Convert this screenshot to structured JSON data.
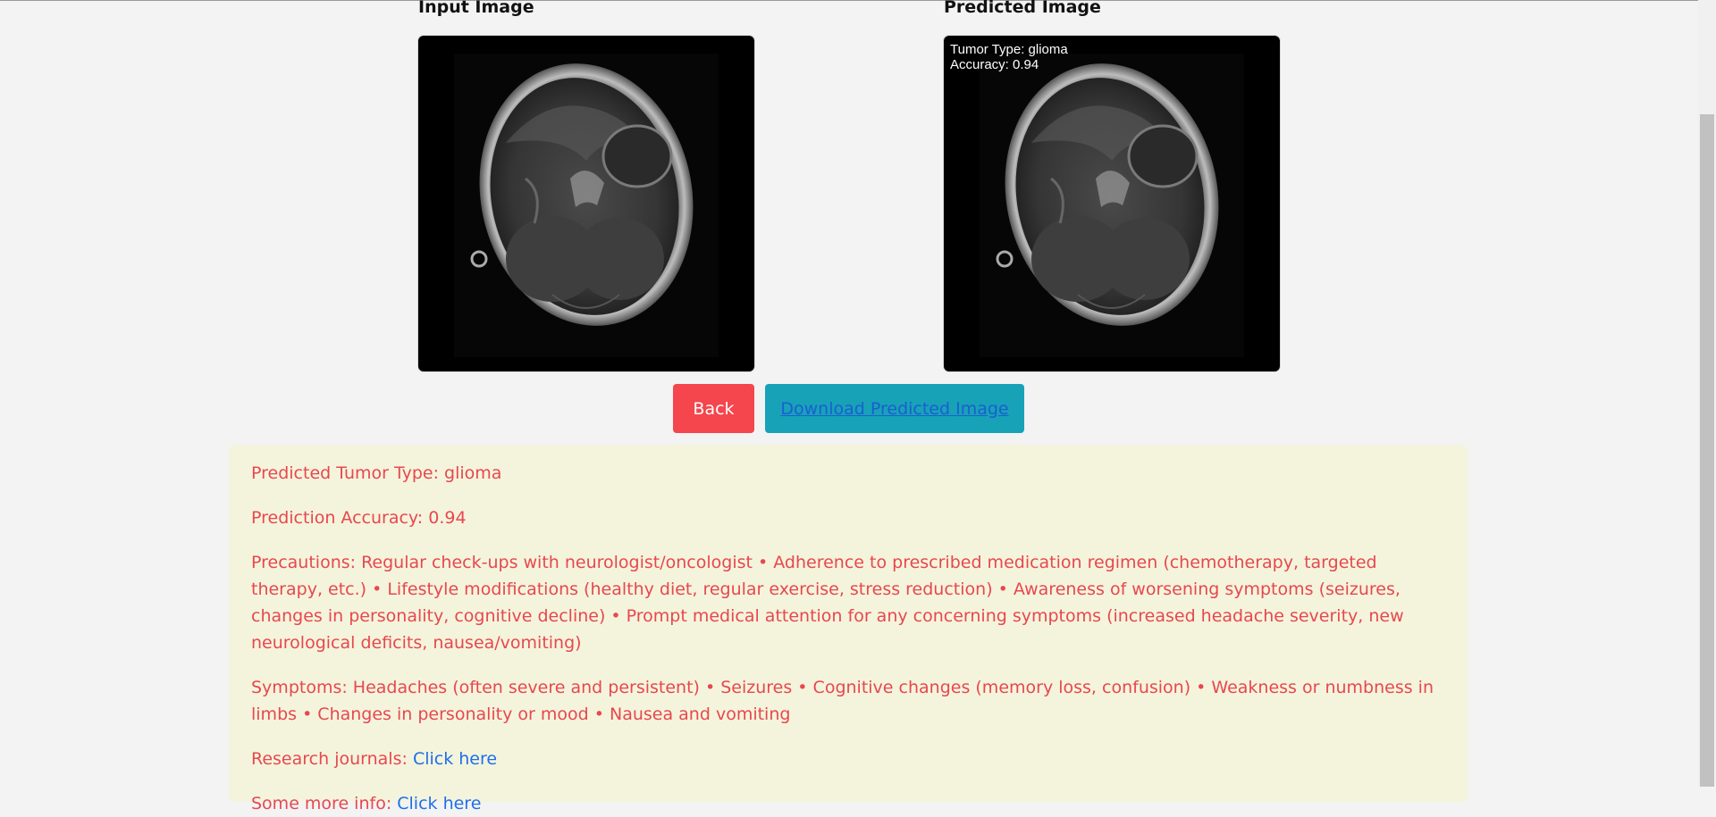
{
  "images": {
    "input_title": "Input Image",
    "predicted_title": "Predicted Image",
    "overlay": {
      "tumor_type_line": "Tumor Type: glioma",
      "accuracy_line": "Accuracy: 0.94"
    }
  },
  "buttons": {
    "back_label": "Back",
    "download_label": "Download Predicted Image"
  },
  "info": {
    "predicted_type": "Predicted Tumor Type: glioma",
    "prediction_accuracy": "Prediction Accuracy: 0.94",
    "precautions": "Precautions: Regular check-ups with neurologist/oncologist • Adherence to prescribed medication regimen (chemotherapy, targeted therapy, etc.) • Lifestyle modifications (healthy diet, regular exercise, stress reduction) • Awareness of worsening symptoms (seizures, changes in personality, cognitive decline) • Prompt medical attention for any concerning symptoms (increased headache severity, new neurological deficits, nausea/vomiting)",
    "symptoms": "Symptoms: Headaches (often severe and persistent) • Seizures • Cognitive changes (memory loss, confusion) • Weakness or numbness in limbs • Changes in personality or mood • Nausea and vomiting",
    "research_label": "Research journals:",
    "research_link": "Click here",
    "more_info_label": "Some more info:",
    "more_info_link": "Click here"
  },
  "colors": {
    "back_button": "#f5454d",
    "download_button": "#17a2b8",
    "info_background": "#f4f4dc",
    "info_text": "#e8474f",
    "link": "#1e6fe8"
  }
}
